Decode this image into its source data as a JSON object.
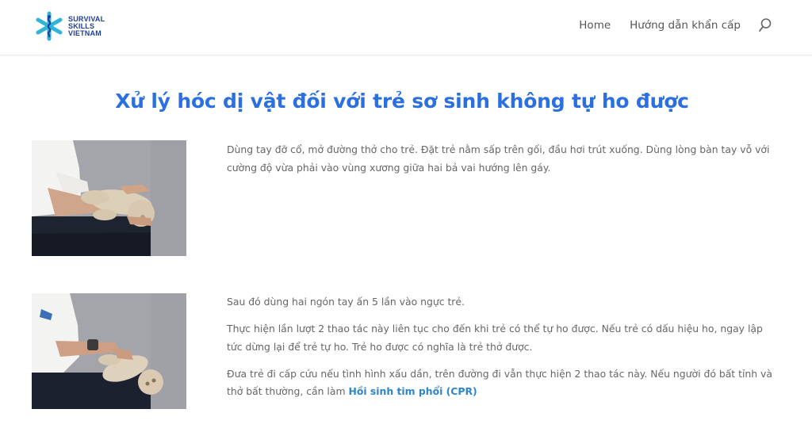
{
  "header": {
    "logo": {
      "line1": "SURVIVAL",
      "line2": "SKILLS",
      "line3": "VIETNAM"
    },
    "nav": {
      "home": "Home",
      "emergency_guide": "Hướng dẫn khẩn cấp"
    },
    "icons": {
      "search": "search-icon",
      "logo": "medical-star-icon"
    }
  },
  "page": {
    "title": "Xử lý hóc dị vật đối với trẻ sơ sinh không tự ho được"
  },
  "steps": [
    {
      "paragraphs": [
        "Dùng tay đỡ cổ, mở đường thở cho trẻ. Đặt trẻ nằm sấp trên gối, đầu hơi trút xuống. Dùng lòng bàn tay vỗ với cường độ vừa phải vào vùng xương giữa hai bả vai hướng lên gáy."
      ]
    },
    {
      "paragraphs": [
        "Sau đó dùng hai ngón tay ấn 5 lần vào ngực trẻ.",
        "Thực hiện lần lượt 2 thao tác này liên tục cho đến khi trẻ có thể tự ho được. Nếu trẻ có dấu hiệu ho, ngay lập tức dừng lại để trẻ tự ho. Trẻ ho được có nghĩa là trẻ thở được.",
        "Đưa trẻ đi cấp cứu nếu tình hình xấu dần, trên đường đi vẫn thực hiện 2 thao tác này. Nếu người đó bất tỉnh và thở bất thường, cần làm "
      ],
      "link_text": "Hồi sinh tim phổi (CPR)"
    }
  ],
  "colors": {
    "title": "#2b6fe0",
    "link": "#2e86c8",
    "logo_blue": "#1d3f9c",
    "logo_cyan": "#2fb4d8"
  }
}
